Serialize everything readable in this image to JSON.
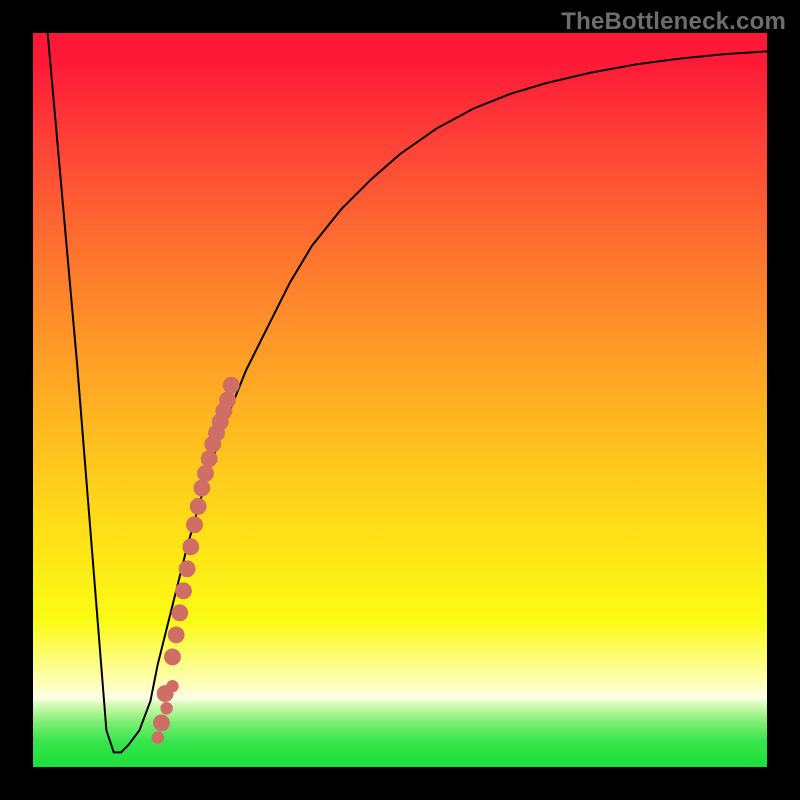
{
  "watermark": "TheBottleneck.com",
  "colors": {
    "line": "#000000",
    "marker": "#cf6e65",
    "frame": "#000000"
  },
  "chart_data": {
    "type": "line",
    "title": "",
    "xlabel": "",
    "ylabel": "",
    "xlim": [
      0,
      100
    ],
    "ylim": [
      0,
      100
    ],
    "grid": false,
    "legend": false,
    "series": [
      {
        "name": "bottleneck-curve",
        "x": [
          2,
          6,
          10,
          11,
          12,
          13,
          14.5,
          16,
          17,
          19,
          21,
          23,
          25,
          27,
          29,
          32,
          35,
          38,
          42,
          46,
          50,
          55,
          60,
          65,
          70,
          76,
          82,
          88,
          94,
          100
        ],
        "y": [
          100,
          55,
          5,
          2,
          2,
          3,
          5,
          9,
          14,
          22,
          30,
          37,
          43.5,
          49,
          54,
          60,
          66,
          71,
          76,
          80,
          83.5,
          87,
          89.7,
          91.7,
          93.2,
          94.6,
          95.7,
          96.5,
          97.1,
          97.5
        ]
      }
    ],
    "markers": [
      {
        "name": "highlight-dots",
        "x": [
          17.5,
          18.0,
          19.0,
          19.5,
          20.0,
          20.5,
          21.0,
          21.5,
          22.0,
          22.5,
          23.0,
          23.5,
          24.0,
          24.5,
          25.0,
          25.5,
          26.0,
          26.5,
          27.0
        ],
        "y": [
          6.0,
          10.0,
          15.0,
          18.0,
          21.0,
          24.0,
          27.0,
          30.0,
          33.0,
          35.5,
          38.0,
          40.0,
          42.0,
          44.0,
          45.5,
          47.0,
          48.5,
          50.0,
          52.0
        ]
      },
      {
        "name": "loose-dots",
        "x": [
          17.0,
          18.2,
          19.0
        ],
        "y": [
          4.0,
          8.0,
          11.0
        ]
      }
    ]
  }
}
